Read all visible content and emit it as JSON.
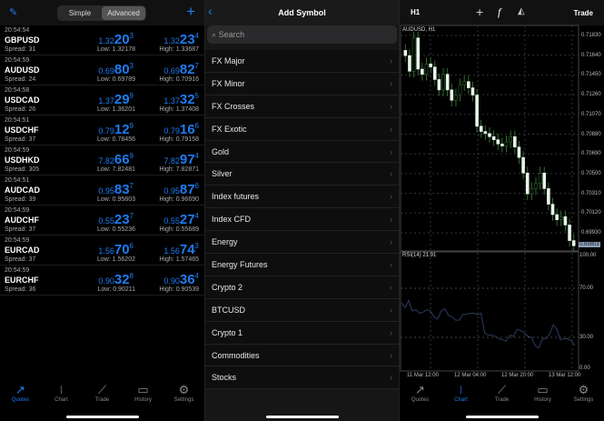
{
  "quotes": {
    "segments": [
      "Simple",
      "Advanced"
    ],
    "rows": [
      {
        "time": "20:54:54",
        "symbol": "GBPUSD",
        "spread": "Spread: 31",
        "bid": [
          "1.32",
          "20",
          "3"
        ],
        "ask": [
          "1.32",
          "23",
          "4"
        ],
        "low": "Low: 1.32178",
        "high": "High: 1.33687"
      },
      {
        "time": "20:54:59",
        "symbol": "AUDUSD",
        "spread": "Spread: 24",
        "bid": [
          "0.69",
          "80",
          "3"
        ],
        "ask": [
          "0.69",
          "82",
          "7"
        ],
        "low": "Low: 0.69789",
        "high": "High: 0.70916"
      },
      {
        "time": "20:54:58",
        "symbol": "USDCAD",
        "spread": "Spread: 26",
        "bid": [
          "1.37",
          "29",
          "9"
        ],
        "ask": [
          "1.37",
          "32",
          "5"
        ],
        "low": "Low: 1.36201",
        "high": "High: 1.37408"
      },
      {
        "time": "20:54:51",
        "symbol": "USDCHF",
        "spread": "Spread: 37",
        "bid": [
          "0.79",
          "12",
          "9"
        ],
        "ask": [
          "0.79",
          "16",
          "6"
        ],
        "low": "Low: 0.78456",
        "high": "High: 0.79158"
      },
      {
        "time": "20:54:59",
        "symbol": "USDHKD",
        "spread": "Spread: 305",
        "bid": [
          "7.82",
          "66",
          "9"
        ],
        "ask": [
          "7.82",
          "97",
          "4"
        ],
        "low": "Low: 7.82481",
        "high": "High: 7.82871"
      },
      {
        "time": "20:54:51",
        "symbol": "AUDCAD",
        "spread": "Spread: 39",
        "bid": [
          "0.95",
          "83",
          "7"
        ],
        "ask": [
          "0.95",
          "87",
          "6"
        ],
        "low": "Low: 0.95803",
        "high": "High: 0.96690"
      },
      {
        "time": "20:54:59",
        "symbol": "AUDCHF",
        "spread": "Spread: 37",
        "bid": [
          "0.55",
          "23",
          "7"
        ],
        "ask": [
          "0.55",
          "27",
          "4"
        ],
        "low": "Low: 0.55236",
        "high": "High: 0.55689"
      },
      {
        "time": "20:54:59",
        "symbol": "EURCAD",
        "spread": "Spread: 37",
        "bid": [
          "1.56",
          "70",
          "6"
        ],
        "ask": [
          "1.56",
          "74",
          "3"
        ],
        "low": "Low: 1.56202",
        "high": "High: 1.57465"
      },
      {
        "time": "20:54:59",
        "symbol": "EURCHF",
        "spread": "Spread: 36",
        "bid": [
          "0.90",
          "32",
          "8"
        ],
        "ask": [
          "0.90",
          "36",
          "4"
        ],
        "low": "Low: 0.90211",
        "high": "High: 0.90539"
      }
    ]
  },
  "tabs": [
    "Quotes",
    "Chart",
    "Trade",
    "History",
    "Settings"
  ],
  "symbols": {
    "title": "Add Symbol",
    "search_placeholder": "Search",
    "categories": [
      "FX Major",
      "FX Minor",
      "FX Crosses",
      "FX Exotic",
      "Gold",
      "Silver",
      "Index futures",
      "Index CFD",
      "Energy",
      "Energy Futures",
      "Crypto 2",
      "BTCUSD",
      "Crypto 1",
      "Commodities",
      "Stocks"
    ]
  },
  "chart": {
    "timeframe": "H1",
    "trade_label": "Trade",
    "label": "AUDUSD, H1",
    "price_ticks": [
      "0.71830",
      "0.71640",
      "0.71450",
      "0.71260",
      "0.71070",
      "0.70880",
      "0.70690",
      "0.70500",
      "0.70310",
      "0.70120",
      "0.69930"
    ],
    "current_price": "0.69803",
    "rsi_label": "RSI(14) 21.91",
    "rsi_ticks": [
      "100.00",
      "70.00",
      "30.00",
      "0.00"
    ],
    "time_ticks": [
      "11 Mar 12:00",
      "12 Mar 04:00",
      "12 Mar 20:00",
      "13 Mar 12:00"
    ]
  },
  "chart_data": {
    "type": "candlestick",
    "ylim": [
      0.6975,
      0.7192
    ],
    "closes": [
      0.7163,
      0.7148,
      0.718,
      0.715,
      0.7145,
      0.7155,
      0.7152,
      0.714,
      0.713,
      0.7145,
      0.713,
      0.712,
      0.7125,
      0.7135,
      0.7138,
      0.7132,
      0.7125,
      0.7095,
      0.709,
      0.7088,
      0.7085,
      0.7082,
      0.7078,
      0.7076,
      0.708,
      0.7085,
      0.7075,
      0.7065,
      0.705,
      0.703,
      0.7035,
      0.704,
      0.705,
      0.7035,
      0.702,
      0.701,
      0.7005,
      0.7008,
      0.7,
      0.6985,
      0.698
    ],
    "rsi": [
      59,
      55,
      61,
      52,
      53,
      50,
      51,
      53,
      52,
      47,
      45,
      52,
      54,
      48,
      47,
      44,
      44,
      49,
      49,
      50,
      50,
      49,
      50,
      33,
      31,
      31,
      30,
      28,
      27,
      26,
      31,
      30,
      36,
      35,
      33,
      30,
      29,
      22,
      20,
      28,
      28,
      32,
      40,
      36,
      27,
      28,
      28,
      26,
      22
    ]
  }
}
